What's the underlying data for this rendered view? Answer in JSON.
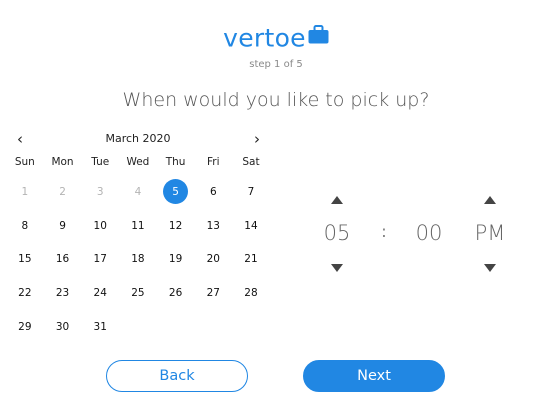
{
  "brand": {
    "name": "vertoe",
    "icon": "briefcase-icon",
    "color": "#2187e3"
  },
  "step_text": "step 1 of 5",
  "question": "When would you like to pick up?",
  "calendar": {
    "month_label": "March 2020",
    "prev_icon": "‹",
    "next_icon": "›",
    "weekdays": [
      "Sun",
      "Mon",
      "Tue",
      "Wed",
      "Thu",
      "Fri",
      "Sat"
    ],
    "days": [
      {
        "label": "1",
        "disabled": true
      },
      {
        "label": "2",
        "disabled": true
      },
      {
        "label": "3",
        "disabled": true
      },
      {
        "label": "4",
        "disabled": true
      },
      {
        "label": "5",
        "selected": true
      },
      {
        "label": "6"
      },
      {
        "label": "7"
      },
      {
        "label": "8"
      },
      {
        "label": "9"
      },
      {
        "label": "10"
      },
      {
        "label": "11"
      },
      {
        "label": "12"
      },
      {
        "label": "13"
      },
      {
        "label": "14"
      },
      {
        "label": "15"
      },
      {
        "label": "16"
      },
      {
        "label": "17"
      },
      {
        "label": "18"
      },
      {
        "label": "19"
      },
      {
        "label": "20"
      },
      {
        "label": "21"
      },
      {
        "label": "22"
      },
      {
        "label": "23"
      },
      {
        "label": "24"
      },
      {
        "label": "25"
      },
      {
        "label": "26"
      },
      {
        "label": "27"
      },
      {
        "label": "28"
      },
      {
        "label": "29"
      },
      {
        "label": "30"
      },
      {
        "label": "31"
      }
    ]
  },
  "time": {
    "hour": "05",
    "separator": ":",
    "minute": "00",
    "period": "PM"
  },
  "buttons": {
    "back": "Back",
    "next": "Next"
  },
  "colors": {
    "accent": "#2187e3",
    "disabled_text": "#b3b3b3",
    "arrow": "#444444"
  }
}
